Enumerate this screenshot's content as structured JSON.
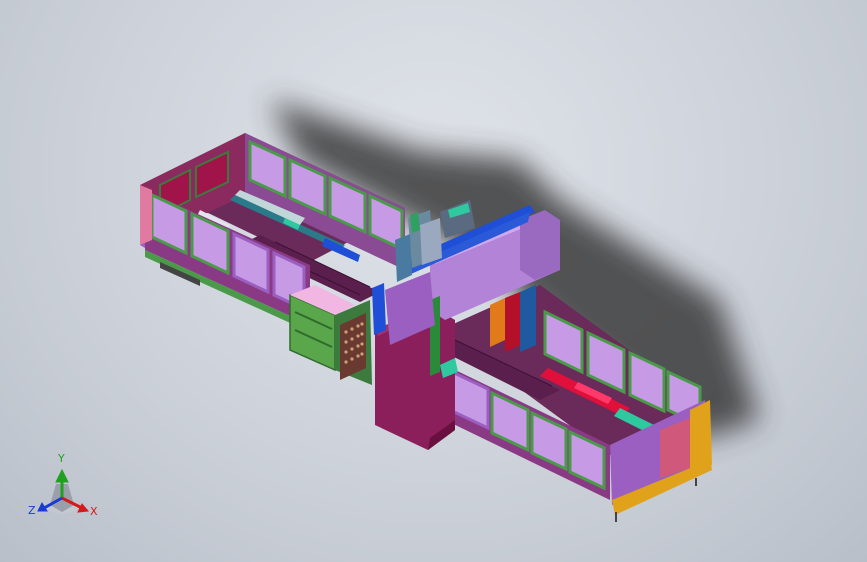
{
  "viewer": {
    "model_description": "",
    "background_top": "#dfe3e9",
    "background_bottom": "#b9bfc9"
  },
  "colors": {
    "panel_frame_green": "#4a9a4a",
    "panel_glass_violet": "#c79ae6",
    "body_magenta": "#8a2a6a",
    "body_purple": "#9a5fc0",
    "accent_blue": "#1f4fd6",
    "accent_red": "#e0103a",
    "accent_teal": "#2fc9a0",
    "accent_yellow": "#e0a21a",
    "shadow": "#3a3a3a"
  },
  "triad": {
    "x_label": "X",
    "y_label": "Y",
    "z_label": "Z",
    "x_color": "#d41a1a",
    "y_color": "#20a020",
    "z_color": "#1a3ad4"
  }
}
